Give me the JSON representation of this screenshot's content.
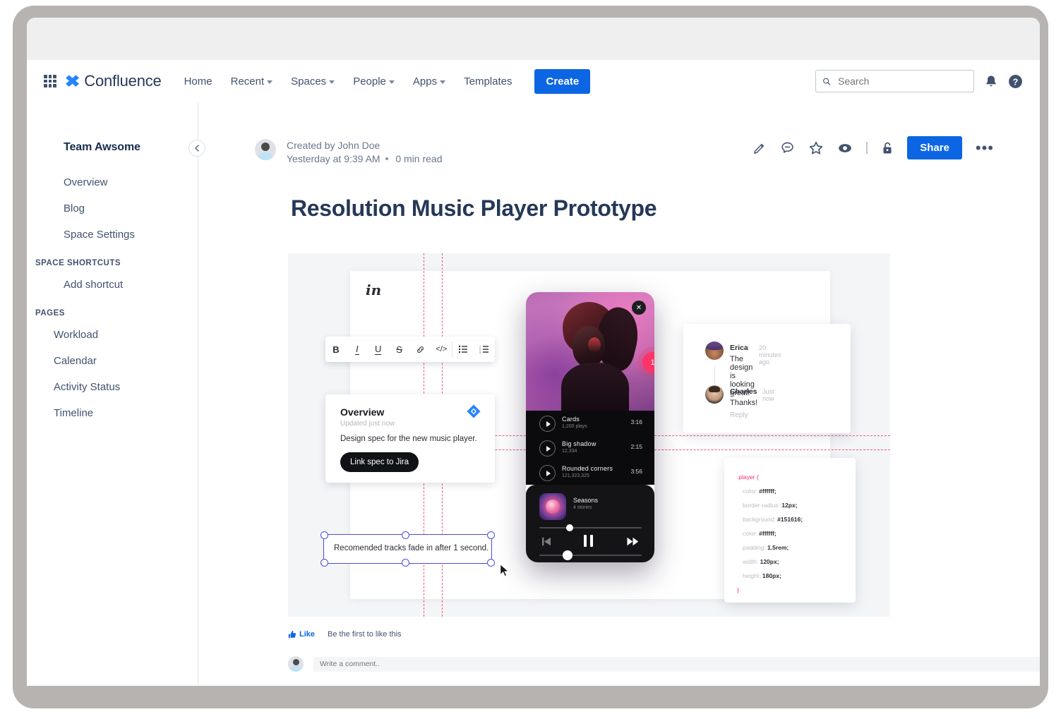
{
  "topnav": {
    "brand": "Confluence",
    "brand_mark": "atlassian-confluence-logo",
    "grid_icon": "app-switcher-icon",
    "items": [
      {
        "label": "Home",
        "caret": false
      },
      {
        "label": "Recent",
        "caret": true
      },
      {
        "label": "Spaces",
        "caret": true
      },
      {
        "label": "People",
        "caret": true
      },
      {
        "label": "Apps",
        "caret": true
      },
      {
        "label": "Templates",
        "caret": false
      }
    ],
    "create_label": "Create",
    "search_placeholder": "Search",
    "search_value": "",
    "notifications_icon": "bell-icon",
    "help_icon": "help-circle-icon",
    "accent_color": "#0c66e4"
  },
  "sidebar": {
    "space_title": "Team Awsome",
    "collapse_icon": "chevron-left-icon",
    "links": [
      "Overview",
      "Blog",
      "Space Settings"
    ],
    "shortcuts_heading": "SPACE SHORTCUTS",
    "shortcuts": [
      "Add shortcut"
    ],
    "pages_heading": "PAGES",
    "pages": [
      "Workload",
      "Calendar",
      "Activity Status",
      "Timeline"
    ]
  },
  "page": {
    "byline_author": "Created by John Doe",
    "byline_meta_date": "Yesterday at 9:39 AM",
    "byline_meta_read": "0 min read",
    "title": "Resolution Music Player Prototype",
    "actions": {
      "edit_icon": "pencil-icon",
      "comment_icon": "comment-icon",
      "watch_icon": "star-icon",
      "views_icon": "eye-icon",
      "restrictions_icon": "unlock-icon",
      "share_label": "Share",
      "more_label": "•••"
    }
  },
  "mockup": {
    "invision_logo": "in",
    "toolbar": [
      {
        "icon": "bold-icon",
        "glyph": "B"
      },
      {
        "icon": "italic-icon",
        "glyph": "I"
      },
      {
        "icon": "underline-icon",
        "glyph": "U"
      },
      {
        "icon": "strikethrough-icon",
        "glyph": "S"
      },
      {
        "icon": "link-icon",
        "glyph": "&#128279;"
      },
      {
        "icon": "code-icon",
        "glyph": "</>"
      },
      {
        "icon": "bullet-list-icon",
        "glyph": "☰"
      },
      {
        "icon": "numbered-list-icon",
        "glyph": "☰"
      }
    ],
    "overview_card": {
      "title": "Overview",
      "subtitle": "Updated just now",
      "description": "Design spec for the new music player.",
      "button_label": "Link spec to Jira",
      "jira_icon": "jira-diamond-icon"
    },
    "selected_textbox": {
      "text": "Recomended tracks fade in after 1 second.",
      "handle_icon": "resize-handle",
      "cursor_icon": "mouse-pointer-icon"
    },
    "phone": {
      "close_icon": "close-x-icon",
      "badge_count": "1",
      "tracks": [
        {
          "name": "Cards",
          "plays": "1,200 plays",
          "duration": "3:16"
        },
        {
          "name": "Big shadow",
          "plays": "12,334",
          "duration": "2:15"
        },
        {
          "name": "Rounded corners",
          "plays": "121,323,325",
          "duration": "3:56"
        }
      ],
      "now_playing": {
        "title": "Seasons",
        "subtitle": "4 stories"
      },
      "controls": {
        "prev_icon": "rewind-icon",
        "play_icon": "pause-icon",
        "next_icon": "fast-forward-icon"
      }
    },
    "comments": [
      {
        "author": "Erica",
        "time": "20 minutes ago",
        "text": "The design is looking great!",
        "reply": ""
      },
      {
        "author": "Charles",
        "time": "Just now",
        "text": "Thanks!",
        "reply": "Reply"
      }
    ],
    "code": {
      "selector": ".player {",
      "closer": "}",
      "lines": [
        {
          "prop": "color:",
          "value": "#ffffff;"
        },
        {
          "prop": "border-radius:",
          "value": "12px;"
        },
        {
          "prop": "background:",
          "value": "#151616;"
        },
        {
          "prop": "color:",
          "value": "#ffffff;"
        },
        {
          "prop": "padding:",
          "value": "1.5rem;"
        },
        {
          "prop": "width:",
          "value": "120px;"
        },
        {
          "prop": "height:",
          "value": "180px;"
        }
      ]
    },
    "guide_color": "#f5537a"
  },
  "footer": {
    "like_icon": "thumbs-up-icon",
    "like_label": "Like",
    "like_note": "Be the first to like this",
    "comment_placeholder": "Write a comment..",
    "comment_value": ""
  }
}
